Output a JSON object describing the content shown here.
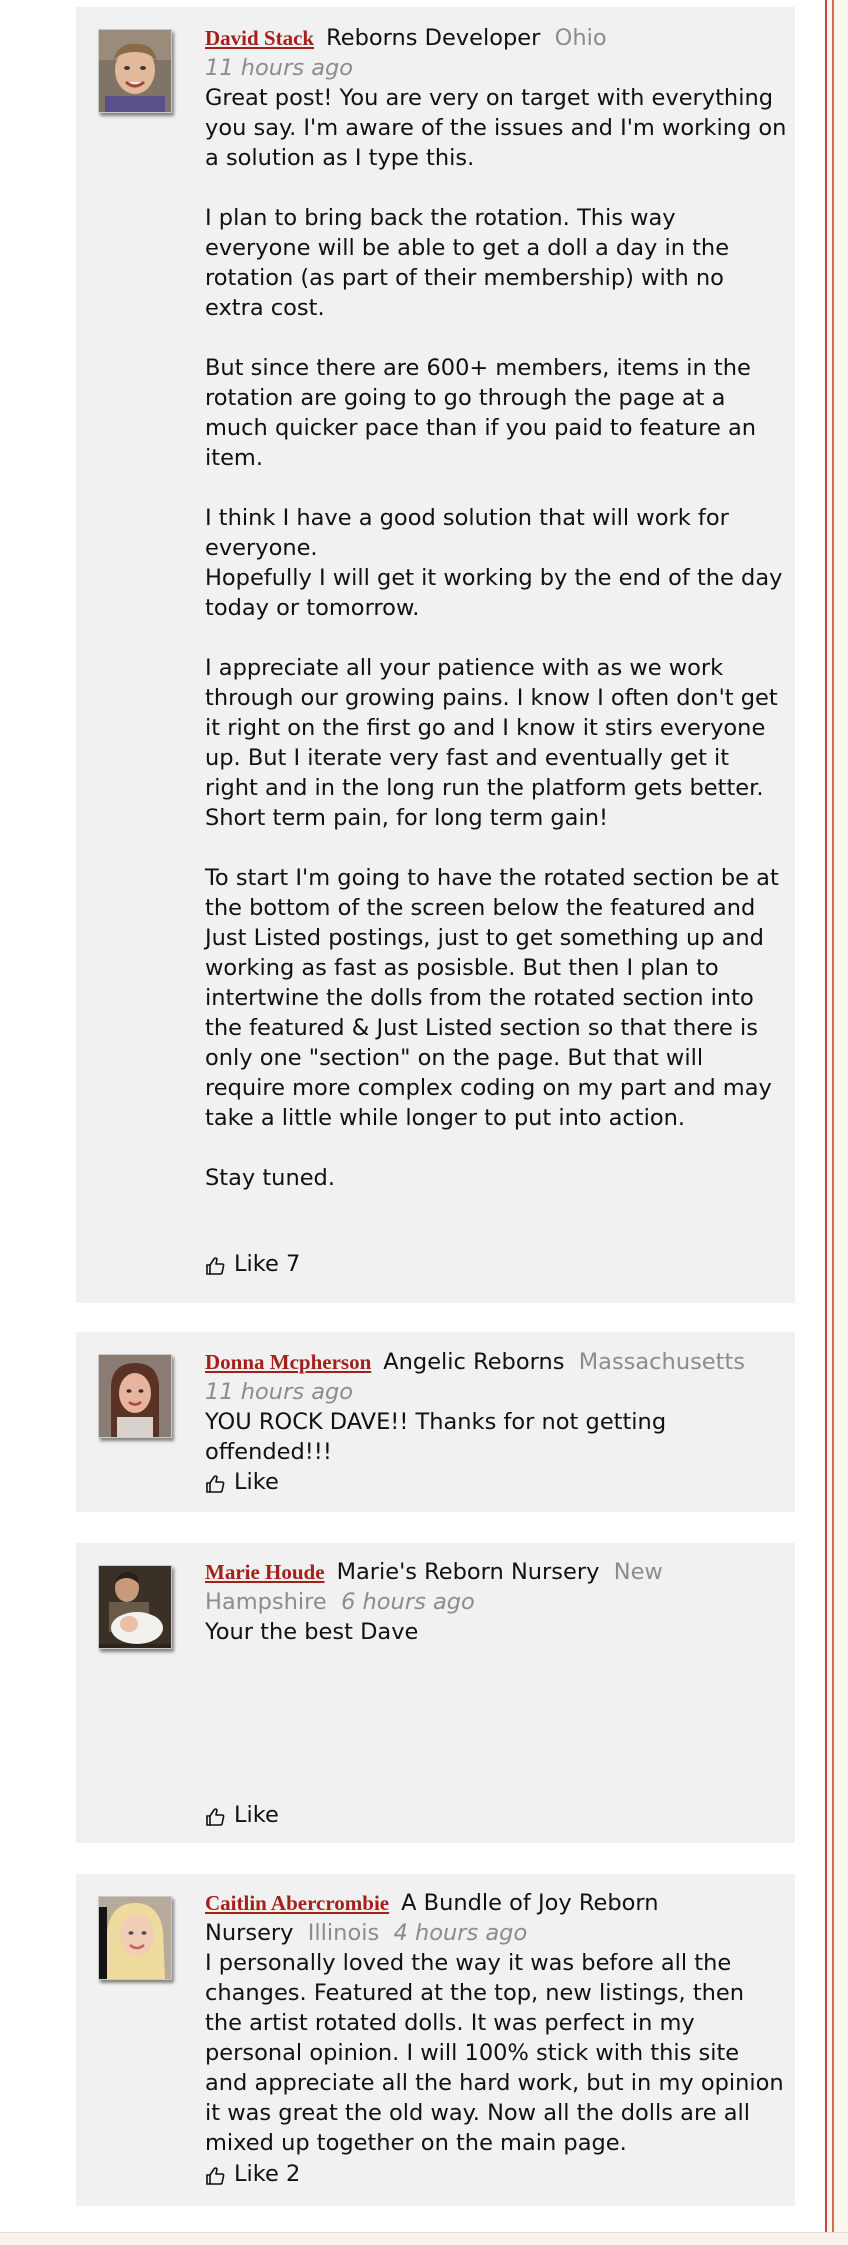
{
  "comments": [
    {
      "author": "David Stack",
      "shop": "Reborns Developer",
      "location": "Ohio",
      "time": "11 hours ago",
      "text": "Great post! You are very on target with everything you say. I'm aware of the issues and I'm working on a solution as I type this.\n\nI plan to bring back the rotation. This way everyone will be able to get a doll a day in the rotation (as part of their membership) with no extra cost.\n\nBut since there are 600+ members, items in the rotation are going to go through the page at a much quicker pace than if you paid to feature an item.\n\nI think I have a good solution that will work for everyone.\nHopefully I will get it working by the end of the day today or tomorrow.\n\nI appreciate all your patience with as we work through our growing pains. I know I often don't get it right on the first go and I know it stirs everyone up. But I iterate very fast and eventually get it right and in the long run the platform gets better. Short term pain, for long term gain!\n\nTo start I'm going to have the rotated section be at the bottom of the screen below the featured and Just Listed postings, just to get something up and working as fast as posisble. But then I plan to intertwine the dolls from the rotated section into the featured & Just Listed section so that there is only one \"section\" on the page. But that will require more complex coding on my part and may take a little while longer to put into action.\n\nStay tuned.",
      "like_label": "Like 7"
    },
    {
      "author": "Donna Mcpherson",
      "shop": "Angelic Reborns",
      "location": "Massachusetts",
      "time": "11 hours ago",
      "text": "YOU ROCK DAVE!! Thanks for not getting offended!!!",
      "like_label": "Like"
    },
    {
      "author": "Marie Houde",
      "shop": "Marie's Reborn Nursery",
      "location": "New Hampshire",
      "time": "6 hours ago",
      "text": "Your the best Dave",
      "like_label": "Like"
    },
    {
      "author": "Caitlin Abercrombie",
      "shop": "A Bundle of Joy Reborn Nursery",
      "location": "Illinois",
      "time": "4 hours ago",
      "text": "I personally loved the way it was before all the changes. Featured at the top, new listings, then the artist rotated dolls. It was perfect in my personal opinion. I will 100% stick with this site and appreciate all the hard work, but in my opinion it was great the old way. Now all the dolls are all mixed up together on the main page.",
      "like_label": "Like 2"
    }
  ],
  "icons": {
    "like": "thumbs-up-icon"
  },
  "colors": {
    "author_link": "#a3201c",
    "muted_text": "#8c8c8c",
    "card_background": "#f1f1f1",
    "right_rule": "#c8433a"
  }
}
